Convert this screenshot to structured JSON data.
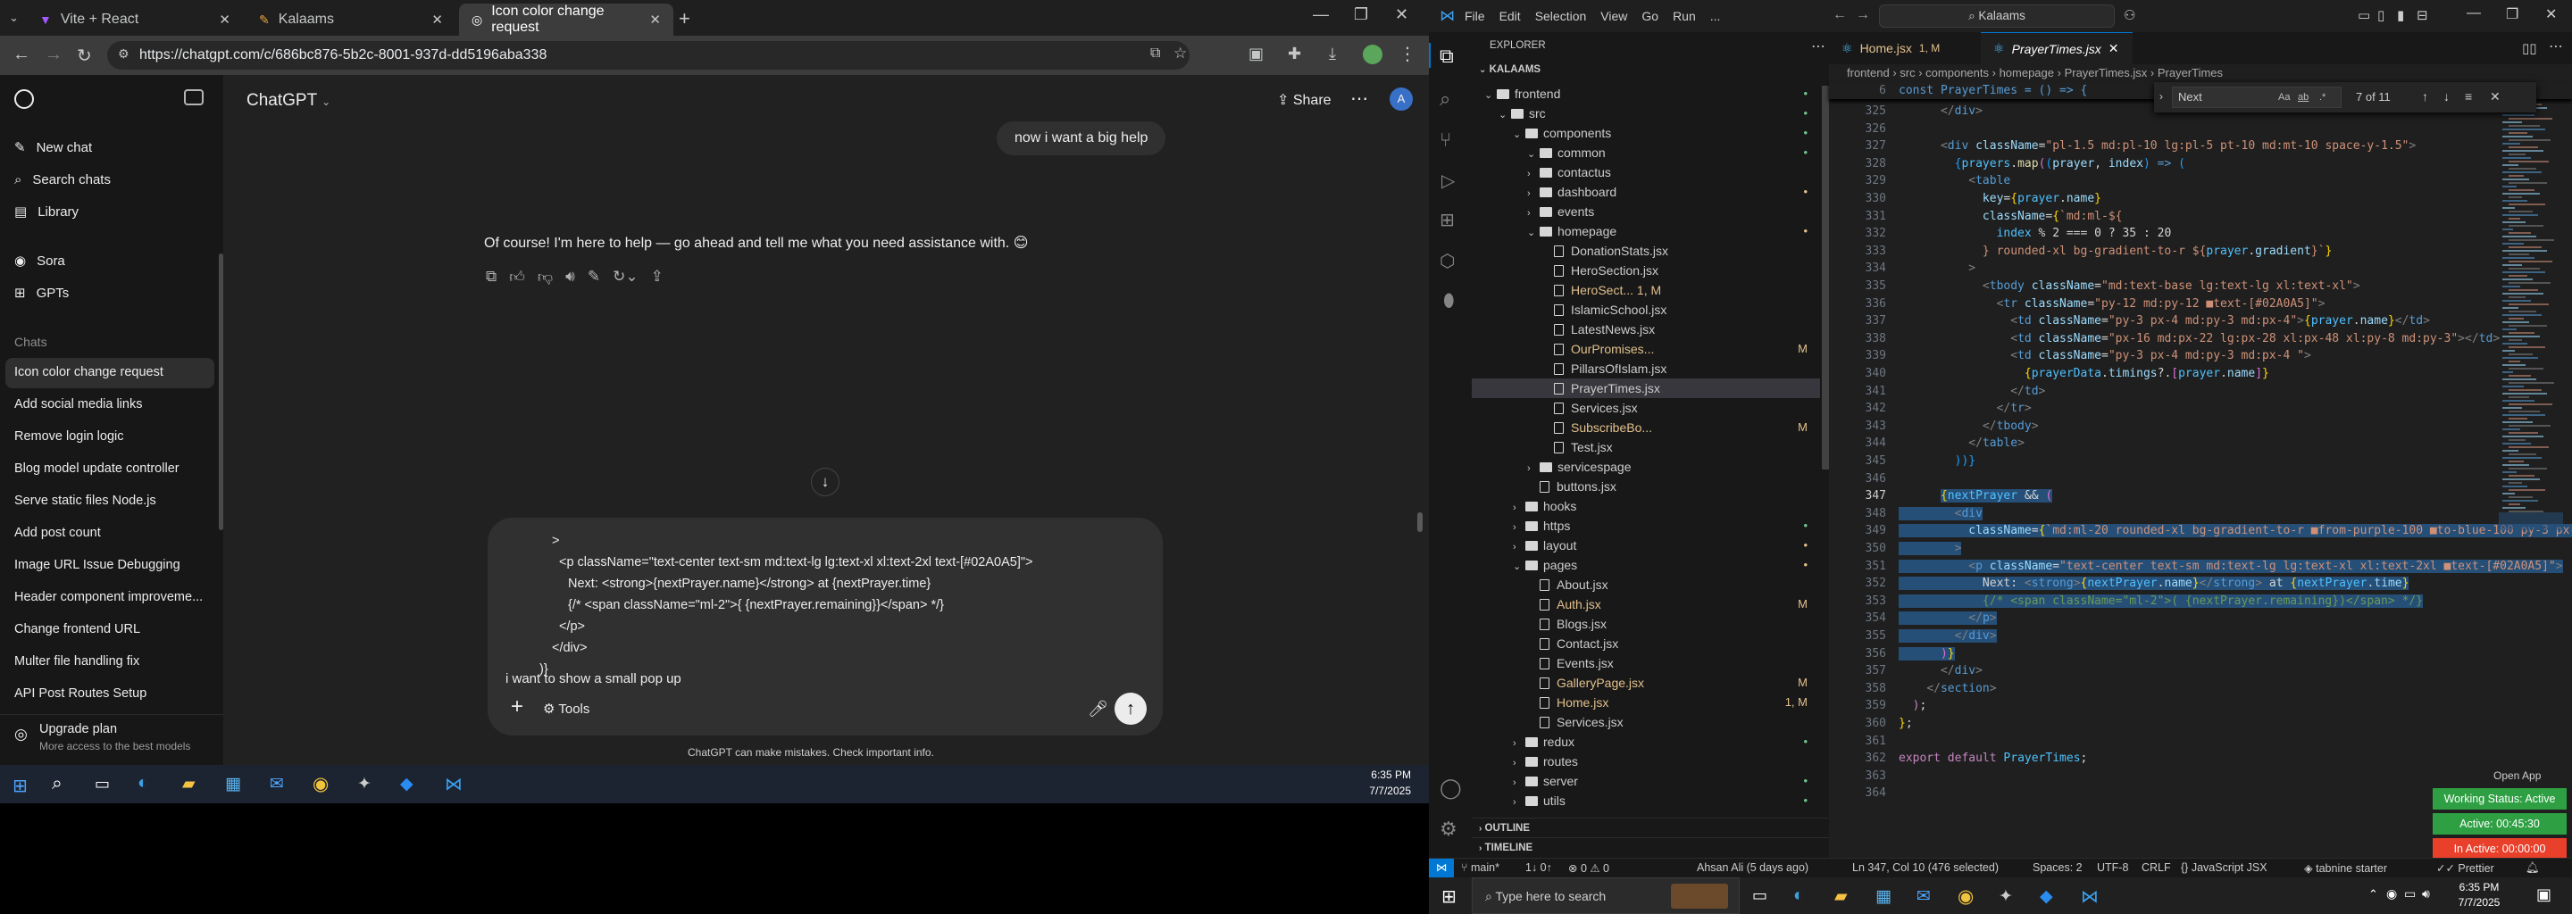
{
  "left_screen": {
    "browser": {
      "tabs": [
        {
          "title": "Vite + React"
        },
        {
          "title": "Kalaams"
        },
        {
          "title": "Icon color change request"
        }
      ],
      "url": "https://chatgpt.com/c/686bc876-5b2c-8001-937d-dd5196aba338"
    },
    "sidebar": {
      "new_chat": "New chat",
      "search_chats": "Search chats",
      "library": "Library",
      "sora": "Sora",
      "gpts": "GPTs",
      "chats_heading": "Chats",
      "chats": [
        "Icon color change request",
        "Add social media links",
        "Remove login logic",
        "Blog model update controller",
        "Serve static files Node.js",
        "Add post count",
        "Image URL Issue Debugging",
        "Header component improveme...",
        "Change frontend URL",
        "Multer file handling fix",
        "API Post Routes Setup"
      ],
      "upgrade_title": "Upgrade plan",
      "upgrade_sub": "More access to the best models"
    },
    "header": {
      "model": "ChatGPT",
      "share": "Share"
    },
    "conversation": {
      "user_message": "now i want a big help",
      "assistant_message": "Of course! I'm here to help — go ahead and tell me what you need assistance with. 😊"
    },
    "composer": {
      "lines": [
        ">",
        "<p className=\"text-center text-sm md:text-lg lg:text-xl xl:text-2xl text-[#02A0A5]\">",
        "Next: <strong>{nextPrayer.name}</strong> at {nextPrayer.time}",
        "{/* <span className=\"ml-2\">{ {nextPrayer.remaining}}</span> */}",
        "</p>",
        "</div>",
        ")}",
        "i want to show a small pop up"
      ],
      "tools": "Tools",
      "disclaimer": "ChatGPT can make mistakes. Check important info."
    },
    "taskbar": {
      "time": "6:35 PM",
      "date": "7/7/2025"
    }
  },
  "right_screen": {
    "title_bar": {
      "menu": [
        "File",
        "Edit",
        "Selection",
        "View",
        "Go",
        "Run",
        "..."
      ],
      "search": "Kalaams"
    },
    "explorer": {
      "heading": "EXPLORER",
      "project": "KALAAMS",
      "tree": [
        {
          "name": "frontend",
          "type": "folder",
          "depth": 0,
          "open": true,
          "mark": "•",
          "mark_color": "#73c991"
        },
        {
          "name": "src",
          "type": "folder",
          "depth": 1,
          "open": true,
          "mark": "•",
          "mark_color": "#73c991"
        },
        {
          "name": "components",
          "type": "folder",
          "depth": 2,
          "open": true,
          "mark": "•",
          "mark_color": "#73c991"
        },
        {
          "name": "common",
          "type": "folder",
          "depth": 3,
          "open": true,
          "mark": "•",
          "mark_color": "#73c991"
        },
        {
          "name": "contactus",
          "type": "folder",
          "depth": 3,
          "open": false,
          "mark": "",
          "mark_color": ""
        },
        {
          "name": "dashboard",
          "type": "folder",
          "depth": 3,
          "open": false,
          "mark": "•",
          "mark_color": "#e2c08d"
        },
        {
          "name": "events",
          "type": "folder",
          "depth": 3,
          "open": false,
          "mark": "",
          "mark_color": ""
        },
        {
          "name": "homepage",
          "type": "folder",
          "depth": 3,
          "open": true,
          "mark": "•",
          "mark_color": "#e2c08d"
        },
        {
          "name": "DonationStats.jsx",
          "type": "file",
          "depth": 4,
          "mark": "",
          "mark_color": ""
        },
        {
          "name": "HeroSection.jsx",
          "type": "file",
          "depth": 4,
          "mark": "",
          "mark_color": ""
        },
        {
          "name": "HeroSect... 1, M",
          "type": "file",
          "depth": 4,
          "mark": "",
          "mark_color": "#e2c08d"
        },
        {
          "name": "IslamicSchool.jsx",
          "type": "file",
          "depth": 4,
          "mark": "",
          "mark_color": ""
        },
        {
          "name": "LatestNews.jsx",
          "type": "file",
          "depth": 4,
          "mark": "",
          "mark_color": ""
        },
        {
          "name": "OurPromises...",
          "type": "file",
          "depth": 4,
          "mark": "M",
          "mark_color": "#e2c08d"
        },
        {
          "name": "PillarsOfIslam.jsx",
          "type": "file",
          "depth": 4,
          "mark": "",
          "mark_color": ""
        },
        {
          "name": "PrayerTimes.jsx",
          "type": "file",
          "depth": 4,
          "mark": "",
          "mark_color": "",
          "selected": true
        },
        {
          "name": "Services.jsx",
          "type": "file",
          "depth": 4,
          "mark": "",
          "mark_color": ""
        },
        {
          "name": "SubscribeBo...",
          "type": "file",
          "depth": 4,
          "mark": "M",
          "mark_color": "#e2c08d"
        },
        {
          "name": "Test.jsx",
          "type": "file",
          "depth": 4,
          "mark": "",
          "mark_color": ""
        },
        {
          "name": "servicespage",
          "type": "folder",
          "depth": 3,
          "open": false,
          "mark": "",
          "mark_color": ""
        },
        {
          "name": "buttons.jsx",
          "type": "file",
          "depth": 3,
          "mark": "",
          "mark_color": ""
        },
        {
          "name": "hooks",
          "type": "folder",
          "depth": 2,
          "open": false,
          "mark": "",
          "mark_color": ""
        },
        {
          "name": "https",
          "type": "folder",
          "depth": 2,
          "open": false,
          "mark": "•",
          "mark_color": "#73c991"
        },
        {
          "name": "layout",
          "type": "folder",
          "depth": 2,
          "open": false,
          "mark": "•",
          "mark_color": "#e2c08d"
        },
        {
          "name": "pages",
          "type": "folder",
          "depth": 2,
          "open": true,
          "mark": "•",
          "mark_color": "#e2c08d"
        },
        {
          "name": "About.jsx",
          "type": "file",
          "depth": 3,
          "mark": "",
          "mark_color": ""
        },
        {
          "name": "Auth.jsx",
          "type": "file",
          "depth": 3,
          "mark": "M",
          "mark_color": "#e2c08d"
        },
        {
          "name": "Blogs.jsx",
          "type": "file",
          "depth": 3,
          "mark": "",
          "mark_color": ""
        },
        {
          "name": "Contact.jsx",
          "type": "file",
          "depth": 3,
          "mark": "",
          "mark_color": ""
        },
        {
          "name": "Events.jsx",
          "type": "file",
          "depth": 3,
          "mark": "",
          "mark_color": ""
        },
        {
          "name": "GalleryPage.jsx",
          "type": "file",
          "depth": 3,
          "mark": "M",
          "mark_color": "#e2c08d"
        },
        {
          "name": "Home.jsx",
          "type": "file",
          "depth": 3,
          "mark": "1, M",
          "mark_color": "#e2c08d"
        },
        {
          "name": "Services.jsx",
          "type": "file",
          "depth": 3,
          "mark": "",
          "mark_color": ""
        },
        {
          "name": "redux",
          "type": "folder",
          "depth": 2,
          "open": false,
          "mark": "•",
          "mark_color": "#73c991"
        },
        {
          "name": "routes",
          "type": "folder",
          "depth": 2,
          "open": false,
          "mark": "",
          "mark_color": ""
        },
        {
          "name": "server",
          "type": "folder",
          "depth": 2,
          "open": false,
          "mark": "•",
          "mark_color": "#73c991"
        },
        {
          "name": "utils",
          "type": "folder",
          "depth": 2,
          "open": false,
          "mark": "•",
          "mark_color": "#73c991"
        }
      ],
      "outline": "OUTLINE",
      "timeline": "TIMELINE"
    },
    "editor": {
      "tabs": [
        {
          "name": "Home.jsx",
          "badge": "1, M"
        },
        {
          "name": "PrayerTimes.jsx",
          "badge": ""
        }
      ],
      "breadcrumb": [
        "frontend",
        "src",
        "components",
        "homepage",
        "PrayerTimes.jsx",
        "PrayerTimes"
      ],
      "find": {
        "query": "Next",
        "count": "7 of 11"
      },
      "sticky_line": {
        "num": "6",
        "text": "const PrayerTimes = () => {"
      },
      "lines": [
        {
          "num": "325",
          "html": "      <span class='tg'>&lt;/</span><span class='t'>div</span><span class='tg'>&gt;</span>"
        },
        {
          "num": "326",
          "html": ""
        },
        {
          "num": "327",
          "html": "      <span class='tg'>&lt;</span><span class='t'>div</span> <span class='a'>className</span>=<span class='s'>\"pl-1.5 md:pl-10 lg:pl-5 pt-10 md:mt-10 space-y-1.5\"</span><span class='tg'>&gt;</span>"
        },
        {
          "num": "328",
          "html": "        <span class='g'>{</span><span class='v'>prayers</span>.<span class='f'>map</span><span class='p'>(</span><span class='g'>(</span><span class='a'>prayer</span>, <span class='a'>index</span><span class='g'>)</span> <span class='t'>=&gt;</span> <span class='g'>(</span>"
        },
        {
          "num": "329",
          "html": "          <span class='tg'>&lt;</span><span class='t'>table</span>"
        },
        {
          "num": "330",
          "html": "            <span class='a'>key</span>=<span class='y'>{</span><span class='v'>prayer</span>.<span class='a'>name</span><span class='y'>}</span>"
        },
        {
          "num": "331",
          "html": "            <span class='a'>className</span>=<span class='y'>{</span><span class='s'>`md:ml-${</span>"
        },
        {
          "num": "332",
          "html": "              <span class='v'>index</span> % <span class='w'>2</span> === <span class='w'>0</span> ? <span class='w'>35</span> : <span class='w'>20</span>"
        },
        {
          "num": "333",
          "html": "            <span class='s'>} rounded-xl bg-gradient-to-r ${</span><span class='v'>prayer</span>.<span class='a'>gradient</span><span class='s'>}`</span><span class='y'>}</span>"
        },
        {
          "num": "334",
          "html": "          <span class='tg'>&gt;</span>"
        },
        {
          "num": "335",
          "html": "            <span class='tg'>&lt;</span><span class='t'>tbody</span> <span class='a'>className</span>=<span class='s'>\"md:text-base lg:text-lg xl:text-xl\"</span><span class='tg'>&gt;</span>"
        },
        {
          "num": "336",
          "html": "              <span class='tg'>&lt;</span><span class='t'>tr</span> <span class='a'>className</span>=<span class='s'>\"py-12 md:py-12 ■text-[#02A0A5]\"</span><span class='tg'>&gt;</span>"
        },
        {
          "num": "337",
          "html": "                <span class='tg'>&lt;</span><span class='t'>td</span> <span class='a'>className</span>=<span class='s'>\"py-3 px-4 md:py-3 md:px-4\"</span><span class='tg'>&gt;</span><span class='y'>{</span><span class='v'>prayer</span>.<span class='a'>name</span><span class='y'>}</span><span class='tg'>&lt;/</span><span class='t'>td</span><span class='tg'>&gt;</span>"
        },
        {
          "num": "338",
          "html": "                <span class='tg'>&lt;</span><span class='t'>td</span> <span class='a'>className</span>=<span class='s'>\"px-16 md:px-22 lg:px-28 xl:px-48 xl:py-8 md:py-3\"</span><span class='tg'>&gt;&lt;/</span><span class='t'>td</span><span class='tg'>&gt;</span>"
        },
        {
          "num": "339",
          "html": "                <span class='tg'>&lt;</span><span class='t'>td</span> <span class='a'>className</span>=<span class='s'>\"py-3 px-4 md:py-3 md:px-4 \"</span><span class='tg'>&gt;</span>"
        },
        {
          "num": "340",
          "html": "                  <span class='y'>{</span><span class='v'>prayerData</span>.<span class='a'>timings</span>?.<span class='p'>[</span><span class='v'>prayer</span>.<span class='a'>name</span><span class='p'>]</span><span class='y'>}</span>"
        },
        {
          "num": "341",
          "html": "                <span class='tg'>&lt;/</span><span class='t'>td</span><span class='tg'>&gt;</span>"
        },
        {
          "num": "342",
          "html": "              <span class='tg'>&lt;/</span><span class='t'>tr</span><span class='tg'>&gt;</span>"
        },
        {
          "num": "343",
          "html": "            <span class='tg'>&lt;/</span><span class='t'>tbody</span><span class='tg'>&gt;</span>"
        },
        {
          "num": "344",
          "html": "          <span class='tg'>&lt;/</span><span class='t'>table</span><span class='tg'>&gt;</span>"
        },
        {
          "num": "345",
          "html": "        <span class='g'>))</span><span class='g'>}</span>"
        },
        {
          "num": "346",
          "html": ""
        },
        {
          "num": "347",
          "html": "      <span class='sel'><span class='y'>{</span><span class='v'>nextPrayer</span> &amp;&amp; <span class='p'>(</span></span>"
        },
        {
          "num": "348",
          "html": "<span class='sel'>        <span class='tg'>&lt;</span><span class='t'>div</span></span>"
        },
        {
          "num": "349",
          "html": "<span class='sel'>          <span class='a'>className</span>=<span class='y'>{</span><span class='s'>`md:ml-20 rounded-xl bg-gradient-to-r ■from-purple-100 ■to-blue-100 py-3 px-4 md</span></span>"
        },
        {
          "num": "350",
          "html": "<span class='sel'>        <span class='tg'>&gt;</span></span>"
        },
        {
          "num": "351",
          "html": "<span class='sel'>          <span class='tg'>&lt;</span><span class='t'>p</span> <span class='a'>className</span>=<span class='s'>\"text-center text-sm md:text-lg lg:text-xl xl:text-2xl ■text-[#02A0A5]\"</span><span class='tg'>&gt;</span></span>"
        },
        {
          "num": "352",
          "html": "<span class='sel'>            <span class='w'>Next:</span> <span class='tg'>&lt;</span><span class='t'>strong</span><span class='tg'>&gt;</span><span class='y'>{</span><span class='v'>nextPrayer</span>.<span class='a'>name</span><span class='y'>}</span><span class='tg'>&lt;/</span><span class='t'>strong</span><span class='tg'>&gt;</span> at <span class='y'>{</span><span class='v'>nextPrayer</span>.<span class='a'>time</span><span class='y'>}</span></span>"
        },
        {
          "num": "353",
          "html": "<span class='sel'>            <span class='c'>{/* &lt;span className=\"ml-2\"&gt;( {nextPrayer.remaining})&lt;/span&gt; */}</span></span>"
        },
        {
          "num": "354",
          "html": "<span class='sel'>          <span class='tg'>&lt;/</span><span class='t'>p</span><span class='tg'>&gt;</span></span>"
        },
        {
          "num": "355",
          "html": "<span class='sel'>        <span class='tg'>&lt;/</span><span class='t'>div</span><span class='tg'>&gt;</span></span>"
        },
        {
          "num": "356",
          "html": "<span class='sel'>      <span class='p'>)</span><span class='y'>}</span></span>"
        },
        {
          "num": "357",
          "html": "      <span class='tg'>&lt;/</span><span class='t'>div</span><span class='tg'>&gt;</span>"
        },
        {
          "num": "358",
          "html": "    <span class='tg'>&lt;/</span><span class='t'>section</span><span class='tg'>&gt;</span>"
        },
        {
          "num": "359",
          "html": "  <span class='k'>)</span>;"
        },
        {
          "num": "360",
          "html": "<span class='y'>}</span>;"
        },
        {
          "num": "361",
          "html": ""
        },
        {
          "num": "362",
          "html": "<span class='k'>export</span> <span class='k'>default</span> <span class='v'>PrayerTimes</span>;"
        },
        {
          "num": "363",
          "html": ""
        },
        {
          "num": "364",
          "html": ""
        }
      ],
      "overlays": {
        "open_app": "Open App",
        "working_status": "Working Status: Active",
        "active_time": "Active: 00:45:30",
        "inactive_time": "In Active: 00:00:00"
      }
    },
    "status_bar": {
      "branch": "main*",
      "sync": "1↓ 0↑",
      "problems": "⊗ 0  ⚠ 0",
      "blame": "Ahsan Ali (5 days ago)",
      "cursor": "Ln 347, Col 10 (476 selected)",
      "spaces": "Spaces: 2",
      "encoding": "UTF-8",
      "eol": "CRLF",
      "language": "{} JavaScript JSX",
      "tabnine": "tabnine starter",
      "prettier": "Prettier"
    },
    "taskbar": {
      "search": "Type here to search",
      "time": "6:35 PM",
      "date": "7/7/2025"
    }
  }
}
